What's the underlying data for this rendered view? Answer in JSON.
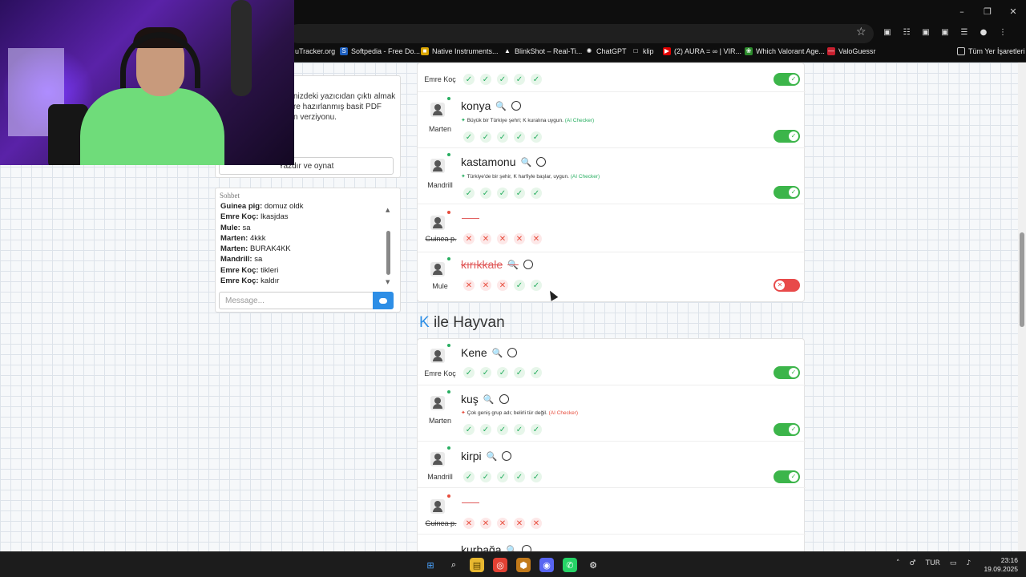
{
  "browser": {
    "window_controls": {
      "minimize": "–",
      "maximize": "❐",
      "close": "✕"
    },
    "star_icon": "☆",
    "extensions": [
      "▣",
      "☷",
      "▣",
      "▣",
      "☰",
      "●",
      "⋮"
    ],
    "bookmarks": [
      {
        "label": "uTracker.org",
        "icon": "",
        "color": "#2a2a2a"
      },
      {
        "label": "Softpedia - Free Do...",
        "icon": "S",
        "color": "#1d5fbf"
      },
      {
        "label": "Native Instruments...",
        "icon": "■",
        "color": "#d9a400"
      },
      {
        "label": "BlinkShot – Real-Ti...",
        "icon": "▲",
        "color": "#1c1c1c"
      },
      {
        "label": "ChatGPT",
        "icon": "✺",
        "color": "#1c1c1c"
      },
      {
        "label": "klip",
        "icon": "□",
        "color": "#1c1c1c"
      },
      {
        "label": "(2) AURA = ∞ | VIR...",
        "icon": "▶",
        "color": "#e00000"
      },
      {
        "label": "Which Valorant Age...",
        "icon": "❀",
        "color": "#2c8c2c"
      },
      {
        "label": "ValoGuessr",
        "icon": "—",
        "color": "#c8202f"
      }
    ],
    "all_bookmarks": "Tüm Yer İşaretleri"
  },
  "left": {
    "description_lines": [
      "nizdeki yazıcıdan çıktı almak",
      "re hazırlanmış basit PDF",
      "n verziyonu."
    ],
    "print_button": "Yazdır ve oynat",
    "chat_title": "Sohbet",
    "messages": [
      {
        "user": "Guinea pig:",
        "text": " domuz oldk"
      },
      {
        "user": "Emre Koç:",
        "text": " lkasjdas"
      },
      {
        "user": "Mule:",
        "text": " sa"
      },
      {
        "user": "Marten:",
        "text": " 4kkk"
      },
      {
        "user": "Marten:",
        "text": " BURAK4KK"
      },
      {
        "user": "Mandrill:",
        "text": " sa"
      },
      {
        "user": "Emre Koç:",
        "text": " tikleri"
      },
      {
        "user": "Emre Koç:",
        "text": " kaldır"
      }
    ],
    "message_placeholder": "Message..."
  },
  "search_icon": "🔍",
  "vote_yes": "✓",
  "vote_no": "✕",
  "checker_icon": "✦",
  "card1": {
    "rows": [
      {
        "player": "Emre Koç",
        "online": true,
        "word": "",
        "checker": "",
        "votes": [
          "y",
          "y",
          "y",
          "y",
          "y"
        ],
        "toggle": true
      },
      {
        "player": "Marten",
        "online": true,
        "word": "konya",
        "checker": "Büyük bir Türkiye şehri; K kuralına uygun.",
        "checker_ok": true,
        "votes": [
          "y",
          "y",
          "y",
          "y",
          "y"
        ],
        "toggle": true
      },
      {
        "player": "Mandrill",
        "online": true,
        "word": "kastamonu",
        "checker": "Türkiye'de bir şehir, K harfiyle başlar, uygun.",
        "checker_ok": true,
        "votes": [
          "y",
          "y",
          "y",
          "y",
          "y"
        ],
        "toggle": true
      },
      {
        "player": "Guinea p.",
        "online": false,
        "word": "",
        "checker": "",
        "votes": [
          "n",
          "n",
          "n",
          "n",
          "n"
        ],
        "toggle": null
      },
      {
        "player": "Mule",
        "online": true,
        "word": "kırıkkale",
        "checker": "",
        "votes": [
          "n",
          "n",
          "n",
          "y",
          "y"
        ],
        "toggle": false
      }
    ]
  },
  "ai_checker_label": "(AI Checker)",
  "section": {
    "letter": "K",
    "title": " ile Hayvan"
  },
  "card2": {
    "rows": [
      {
        "player": "Emre Koç",
        "online": true,
        "word": "Kene",
        "votes": [
          "y",
          "y",
          "y",
          "y",
          "y"
        ],
        "toggle": true
      },
      {
        "player": "Marten",
        "online": true,
        "word": "kuş",
        "checker": "Çok geniş grup adı; belirli tür değil.",
        "checker_ok": false,
        "votes": [
          "y",
          "y",
          "y",
          "y",
          "y"
        ],
        "toggle": true
      },
      {
        "player": "Mandrill",
        "online": true,
        "word": "kirpi",
        "votes": [
          "y",
          "y",
          "y",
          "y",
          "y"
        ],
        "toggle": true
      },
      {
        "player": "Guinea p.",
        "online": false,
        "word": "",
        "votes": [
          "n",
          "n",
          "n",
          "n",
          "n"
        ],
        "toggle": null
      },
      {
        "player": "",
        "online": true,
        "word": "kurbağa"
      }
    ]
  },
  "taskbar": {
    "icons": [
      "⊞",
      "⌕",
      "▤",
      "◎",
      "⬢",
      "◉",
      "✆",
      "⚙"
    ],
    "tray": [
      "˄",
      "♂",
      "TUR",
      "▭",
      "♪"
    ],
    "time": "23:16",
    "date": "19.09.2025"
  }
}
